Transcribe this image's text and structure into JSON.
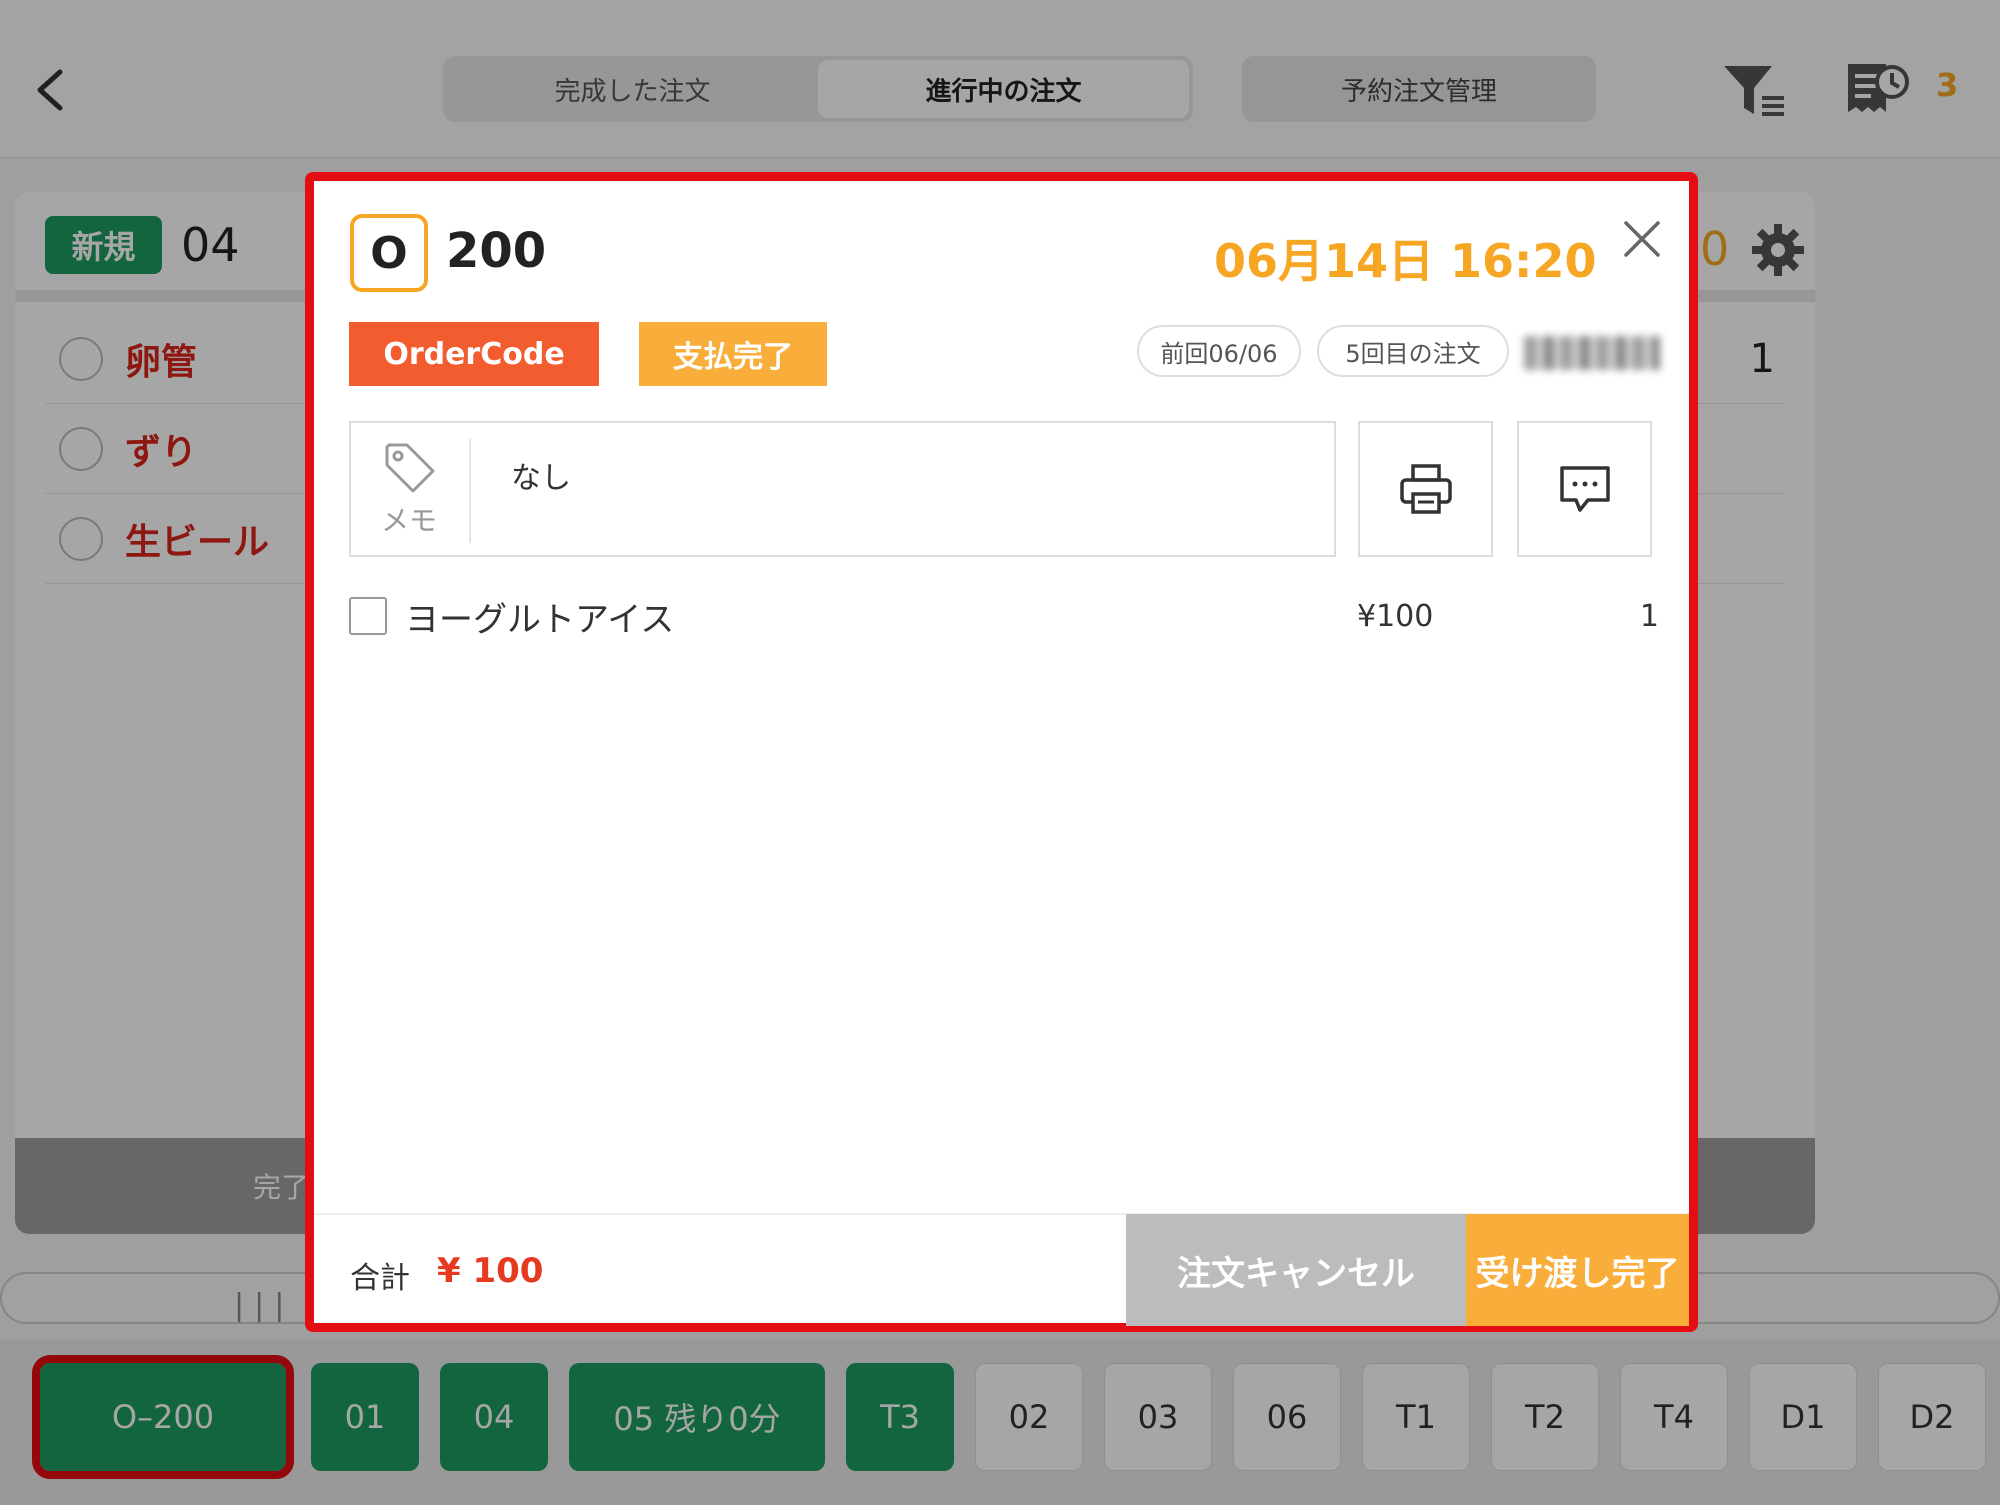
{
  "topbar": {
    "tabs": [
      {
        "label": "完成した注文"
      },
      {
        "label": "進行中の注文"
      }
    ],
    "reserve_label": "予約注文管理",
    "receipt_count": "3"
  },
  "order_card": {
    "badge": "新規",
    "number": "04",
    "timer": "0",
    "items": [
      {
        "name": "卵管",
        "qty": "1"
      },
      {
        "name": "ずり",
        "qty": ""
      },
      {
        "name": "生ビール",
        "qty": ""
      }
    ],
    "footer_label": "完了"
  },
  "table_bar": {
    "buttons": [
      {
        "label": "O–200"
      },
      {
        "label": "01"
      },
      {
        "label": "04"
      },
      {
        "label": "05 残り0分"
      },
      {
        "label": "T3"
      },
      {
        "label": "02"
      },
      {
        "label": "03"
      },
      {
        "label": "06"
      },
      {
        "label": "T1"
      },
      {
        "label": "T2"
      },
      {
        "label": "T4"
      },
      {
        "label": "D1"
      },
      {
        "label": "D2"
      }
    ]
  },
  "modal": {
    "type_letter": "O",
    "order_number": "200",
    "datetime": "06月14日 16:20",
    "tags": {
      "ordercode": "OrderCode",
      "paid": "支払完了"
    },
    "pills": {
      "last_visit": "前回06/06",
      "visit_count": "5回目の注文"
    },
    "memo": {
      "label": "メモ",
      "text": "なし"
    },
    "items": [
      {
        "name": "ヨーグルトアイス",
        "price": "¥100",
        "qty": "1"
      }
    ],
    "footer": {
      "total_label": "合計",
      "total_value": "¥ 100",
      "cancel_label": "注文キャンセル",
      "complete_label": "受け渡し完了"
    }
  },
  "colors": {
    "accent_orange": "#f6a623",
    "brand_green": "#1d9b61",
    "alert_red": "#e30d13",
    "ordercode_orange": "#f25c2e",
    "item_red": "#d9261c"
  }
}
